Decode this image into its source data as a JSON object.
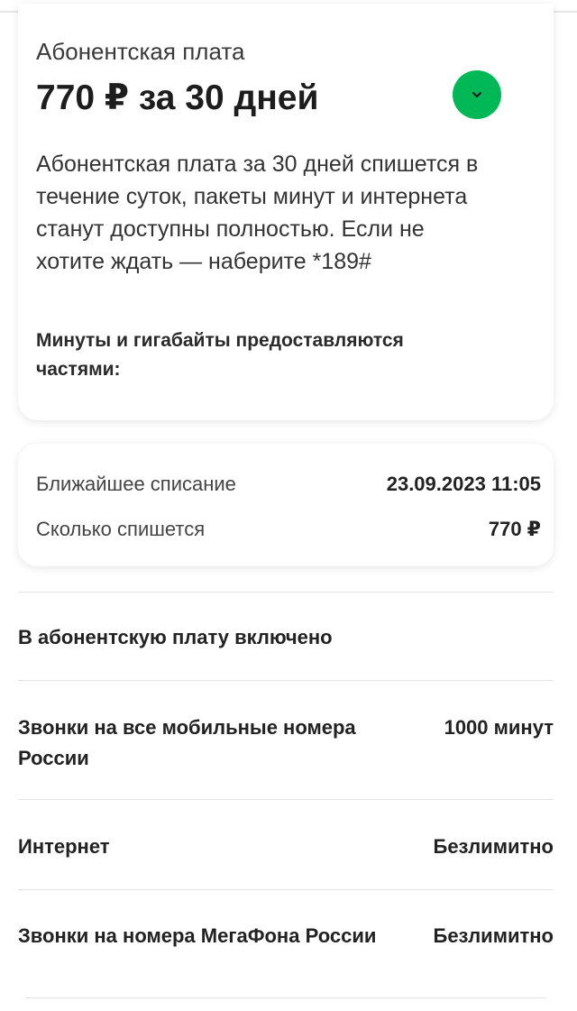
{
  "tariff_card": {
    "label": "Абонентская плата",
    "price": "770 ₽ за 30 дней",
    "description": "Абонентская плата за 30 дней спишется в течение суток, пакеты минут и интернета станут доступны полностью. Если не хотите ждать — наберите *189#",
    "note": "Минуты и гигабайты предоставляются частями:",
    "expand_icon": "chevron-down-icon",
    "accent_color": "#00b956"
  },
  "charge_card": {
    "next_charge_label": "Ближайшее списание",
    "next_charge_value": "23.09.2023 11:05",
    "amount_label": "Сколько спишется",
    "amount_value": "770 ₽"
  },
  "included": {
    "title": "В абонентскую плату включено",
    "items": [
      {
        "name": "Звонки на все мобильные номера России",
        "value": "1000 минут"
      },
      {
        "name": "Интернет",
        "value": "Безлимитно"
      },
      {
        "name": "Звонки на номера МегаФона России",
        "value": "Безлимитно"
      }
    ]
  }
}
